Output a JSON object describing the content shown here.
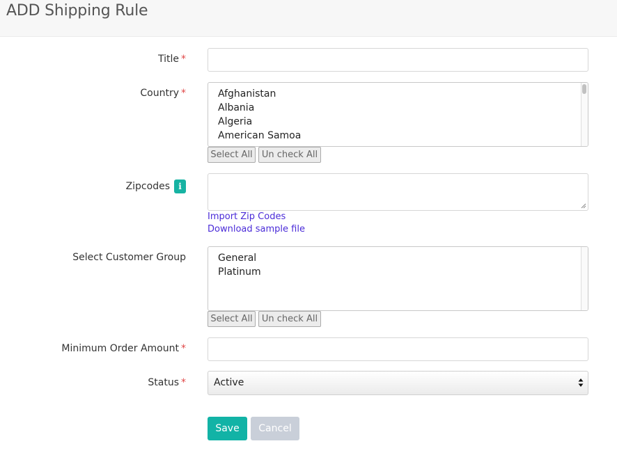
{
  "page": {
    "title": "ADD Shipping Rule"
  },
  "form": {
    "title": {
      "label": "Title",
      "required_mark": "*",
      "value": ""
    },
    "country": {
      "label": "Country",
      "required_mark": "*",
      "options": [
        "Afghanistan",
        "Albania",
        "Algeria",
        "American Samoa"
      ],
      "select_all_label": "Select All",
      "uncheck_all_label": "Un check All"
    },
    "zipcodes": {
      "label": "Zipcodes",
      "info_icon": "info-icon",
      "info_glyph": "i",
      "value": "",
      "import_link": "Import Zip Codes",
      "download_link": "Download sample file"
    },
    "customer_group": {
      "label": "Select Customer Group",
      "options": [
        "General",
        "Platinum"
      ],
      "select_all_label": "Select All",
      "uncheck_all_label": "Un check All"
    },
    "min_order": {
      "label": "Minimum Order Amount",
      "required_mark": "*",
      "value": ""
    },
    "status": {
      "label": "Status",
      "required_mark": "*",
      "selected": "Active"
    }
  },
  "actions": {
    "save_label": "Save",
    "cancel_label": "Cancel"
  },
  "colors": {
    "accent": "#12b3a6",
    "required": "#e04848",
    "link": "#4a2bd8",
    "cancel_disabled": "#c9cfd9"
  }
}
